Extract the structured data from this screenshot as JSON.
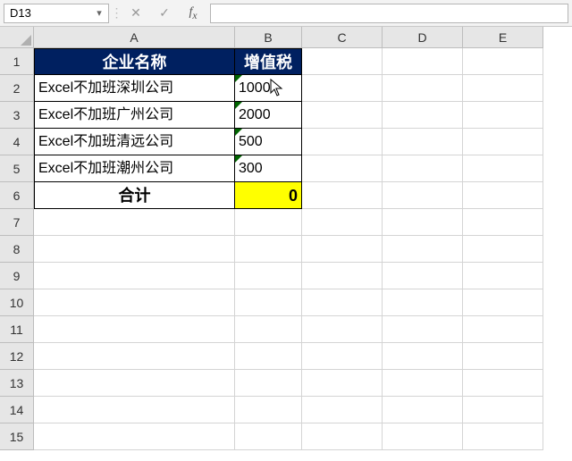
{
  "formula_bar": {
    "name_box_value": "D13",
    "formula_value": ""
  },
  "columns": [
    {
      "letter": "A",
      "width_class": "wA"
    },
    {
      "letter": "B",
      "width_class": "wB"
    },
    {
      "letter": "C",
      "width_class": "wC"
    },
    {
      "letter": "D",
      "width_class": "wD"
    },
    {
      "letter": "E",
      "width_class": "wE"
    }
  ],
  "visible_row_count": 15,
  "table": {
    "headers": {
      "A": "企业名称",
      "B": "增值税"
    },
    "rows": [
      {
        "A": "Excel不加班深圳公司",
        "B": "1000"
      },
      {
        "A": "Excel不加班广州公司",
        "B": "2000"
      },
      {
        "A": "Excel不加班清远公司",
        "B": "500"
      },
      {
        "A": "Excel不加班潮州公司",
        "B": "300"
      }
    ],
    "total_label": "合计",
    "total_value": "0"
  }
}
